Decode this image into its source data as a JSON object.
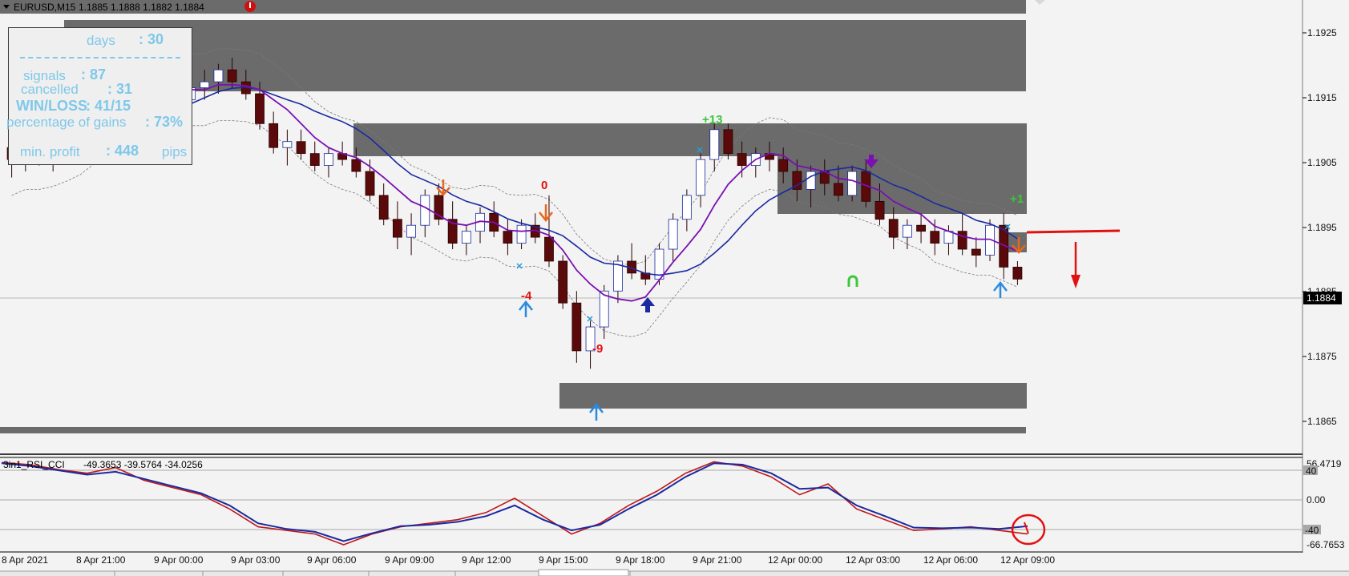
{
  "header": {
    "symbol": "EURUSD,M15",
    "prices": "1.1885 1.1888 1.1882 1.1884"
  },
  "price_axis": {
    "ticks": [
      "1.1925",
      "1.1915",
      "1.1905",
      "1.1895",
      "1.1885",
      "1.1875",
      "1.1865"
    ],
    "current": "1.1884"
  },
  "stats": {
    "days_label": "days",
    "days_value": ": 30",
    "signals_label": "signals",
    "signals_value": ": 87",
    "cancelled_label": "cancelled",
    "cancelled_value": ": 31",
    "winloss_label": "WIN/LOSS",
    "winloss_value": ": 41/15",
    "gains_label": "percentage of gains",
    "gains_value": ": 73%",
    "profit_label": "min. profit",
    "profit_value": ": 448",
    "profit_unit": "pips"
  },
  "signal_labels": {
    "plus13": "+13",
    "zero": "0",
    "minus4": "-4",
    "minus9": "-9",
    "plus1": "+1"
  },
  "indicator": {
    "title": "3in1_RSI_CCI",
    "values": "-49.3653 -39.5764 -34.0256",
    "max": "56.4719",
    "min": "-66.7653",
    "level_hi": "40",
    "level_mid": "0.00",
    "level_lo": "-40"
  },
  "time_axis": {
    "ticks": [
      "8 Apr 2021",
      "8 Apr 21:00",
      "9 Apr 00:00",
      "9 Apr 03:00",
      "9 Apr 06:00",
      "9 Apr 09:00",
      "9 Apr 12:00",
      "9 Apr 15:00",
      "9 Apr 18:00",
      "9 Apr 21:00",
      "12 Apr 00:00",
      "12 Apr 03:00",
      "12 Apr 06:00",
      "12 Apr 09:00"
    ]
  },
  "colors": {
    "zone": "#6b6b6b",
    "bull_candle": "#ffffff",
    "bear_candle": "#5a0a0a",
    "purple_line": "#7a10b0",
    "blue_line": "#1a2aa0",
    "rsi_red": "#c01818",
    "rsi_blue": "#1a2aa0",
    "arrow_orange": "#e8671a",
    "arrow_blue": "#2a8ae0",
    "arrow_red": "#e31010",
    "label_green": "#3ac83a",
    "label_red": "#e31010",
    "stats_text": "#7fc8ea"
  },
  "chart_data": {
    "type": "candlestick",
    "symbol": "EURUSD",
    "timeframe": "M15",
    "y_range": [
      1.1861,
      1.1928
    ],
    "last_price": 1.1884,
    "candles_ohlc": [
      [
        1.1906,
        1.1909,
        1.1901,
        1.1904
      ],
      [
        1.1904,
        1.1908,
        1.1902,
        1.1906
      ],
      [
        1.1906,
        1.1909,
        1.1903,
        1.1905
      ],
      [
        1.1905,
        1.1908,
        1.1902,
        1.1907
      ],
      [
        1.1907,
        1.1911,
        1.1905,
        1.191
      ],
      [
        1.191,
        1.1914,
        1.1908,
        1.1913
      ],
      [
        1.1913,
        1.1916,
        1.1911,
        1.1915
      ],
      [
        1.1915,
        1.1918,
        1.1913,
        1.1916
      ],
      [
        1.1916,
        1.1919,
        1.1914,
        1.1917
      ],
      [
        1.1917,
        1.1919,
        1.1913,
        1.1914
      ],
      [
        1.1914,
        1.1918,
        1.1912,
        1.1917
      ],
      [
        1.1917,
        1.1919,
        1.1915,
        1.1916
      ],
      [
        1.1916,
        1.1918,
        1.1913,
        1.1914
      ],
      [
        1.1914,
        1.1917,
        1.1912,
        1.1916
      ],
      [
        1.1916,
        1.1919,
        1.1914,
        1.1917
      ],
      [
        1.1917,
        1.192,
        1.1915,
        1.1919
      ],
      [
        1.1919,
        1.1921,
        1.1916,
        1.1917
      ],
      [
        1.1917,
        1.1919,
        1.1914,
        1.1915
      ],
      [
        1.1915,
        1.1917,
        1.1909,
        1.191
      ],
      [
        1.191,
        1.1912,
        1.1905,
        1.1906
      ],
      [
        1.1906,
        1.1909,
        1.1903,
        1.1907
      ],
      [
        1.1907,
        1.1909,
        1.1904,
        1.1905
      ],
      [
        1.1905,
        1.1907,
        1.1902,
        1.1903
      ],
      [
        1.1903,
        1.1906,
        1.1901,
        1.1905
      ],
      [
        1.1905,
        1.1907,
        1.1903,
        1.1904
      ],
      [
        1.1904,
        1.1906,
        1.1901,
        1.1902
      ],
      [
        1.1902,
        1.1904,
        1.1897,
        1.1898
      ],
      [
        1.1898,
        1.19,
        1.1893,
        1.1894
      ],
      [
        1.1894,
        1.1897,
        1.1889,
        1.1891
      ],
      [
        1.1891,
        1.1895,
        1.1888,
        1.1893
      ],
      [
        1.1893,
        1.1899,
        1.1891,
        1.1898
      ],
      [
        1.1898,
        1.19,
        1.1893,
        1.1894
      ],
      [
        1.1894,
        1.1897,
        1.1889,
        1.189
      ],
      [
        1.189,
        1.1893,
        1.1888,
        1.1892
      ],
      [
        1.1892,
        1.1896,
        1.189,
        1.1895
      ],
      [
        1.1895,
        1.1897,
        1.1891,
        1.1892
      ],
      [
        1.1892,
        1.1894,
        1.1888,
        1.189
      ],
      [
        1.189,
        1.1894,
        1.1889,
        1.1893
      ],
      [
        1.1893,
        1.1895,
        1.189,
        1.1891
      ],
      [
        1.1891,
        1.1898,
        1.1886,
        1.1887
      ],
      [
        1.1887,
        1.1888,
        1.1879,
        1.188
      ],
      [
        1.188,
        1.1882,
        1.187,
        1.1872
      ],
      [
        1.1872,
        1.1877,
        1.1869,
        1.1876
      ],
      [
        1.1876,
        1.1883,
        1.1874,
        1.1882
      ],
      [
        1.1882,
        1.1888,
        1.188,
        1.1887
      ],
      [
        1.1887,
        1.189,
        1.1884,
        1.1885
      ],
      [
        1.1885,
        1.1888,
        1.1883,
        1.1884
      ],
      [
        1.1884,
        1.189,
        1.1883,
        1.1889
      ],
      [
        1.1889,
        1.1895,
        1.1887,
        1.1894
      ],
      [
        1.1894,
        1.1899,
        1.1892,
        1.1898
      ],
      [
        1.1898,
        1.1905,
        1.1896,
        1.1904
      ],
      [
        1.1904,
        1.191,
        1.1902,
        1.1909
      ],
      [
        1.1909,
        1.191,
        1.1904,
        1.1905
      ],
      [
        1.1905,
        1.1907,
        1.1901,
        1.1903
      ],
      [
        1.1903,
        1.1906,
        1.1901,
        1.1905
      ],
      [
        1.1905,
        1.1907,
        1.1902,
        1.1904
      ],
      [
        1.1904,
        1.1906,
        1.19,
        1.1902
      ],
      [
        1.1902,
        1.1904,
        1.1897,
        1.1899
      ],
      [
        1.1899,
        1.1903,
        1.1896,
        1.1902
      ],
      [
        1.1902,
        1.1904,
        1.1898,
        1.19
      ],
      [
        1.19,
        1.1903,
        1.1897,
        1.1898
      ],
      [
        1.1898,
        1.1903,
        1.1897,
        1.1902
      ],
      [
        1.1902,
        1.1904,
        1.1896,
        1.1897
      ],
      [
        1.1897,
        1.19,
        1.1893,
        1.1894
      ],
      [
        1.1894,
        1.1896,
        1.1889,
        1.1891
      ],
      [
        1.1891,
        1.1894,
        1.1889,
        1.1893
      ],
      [
        1.1893,
        1.1895,
        1.189,
        1.1892
      ],
      [
        1.1892,
        1.1894,
        1.1888,
        1.189
      ],
      [
        1.189,
        1.1893,
        1.1888,
        1.1892
      ],
      [
        1.1892,
        1.1895,
        1.1888,
        1.1889
      ],
      [
        1.1889,
        1.1891,
        1.1886,
        1.1888
      ],
      [
        1.1888,
        1.1894,
        1.1887,
        1.1893
      ],
      [
        1.1893,
        1.1895,
        1.1884,
        1.1886
      ],
      [
        1.1886,
        1.1887,
        1.1883,
        1.1884
      ]
    ],
    "zones": [
      [
        1.1916,
        1.1926
      ],
      [
        1.1897,
        1.1908
      ],
      [
        1.1868,
        1.1872
      ],
      [
        1.1865,
        1.1866
      ],
      [
        1.1927,
        1.1928
      ]
    ],
    "indicator_series": [
      {
        "name": "3in1_RSI_CCI line 1",
        "values": [
          55,
          52,
          45,
          40,
          48,
          30,
          20,
          10,
          -10,
          -35,
          -40,
          -45,
          -60,
          -45,
          -35,
          -30,
          -25,
          -15,
          5,
          -20,
          -45,
          -30,
          -5,
          15,
          40,
          56,
          50,
          35,
          10,
          25,
          -10,
          -25,
          -40,
          -38,
          -35,
          -40,
          -45
        ]
      },
      {
        "name": "3in1_RSI_CCI line 2",
        "values": [
          54,
          50,
          44,
          38,
          42,
          32,
          22,
          12,
          -5,
          -30,
          -38,
          -42,
          -55,
          -44,
          -34,
          -32,
          -28,
          -20,
          -5,
          -25,
          -40,
          -32,
          -10,
          10,
          35,
          54,
          52,
          40,
          18,
          20,
          -5,
          -20,
          -36,
          -37,
          -36,
          -38,
          -34
        ]
      }
    ],
    "indicator_range": [
      -66.7653,
      56.4719
    ]
  }
}
